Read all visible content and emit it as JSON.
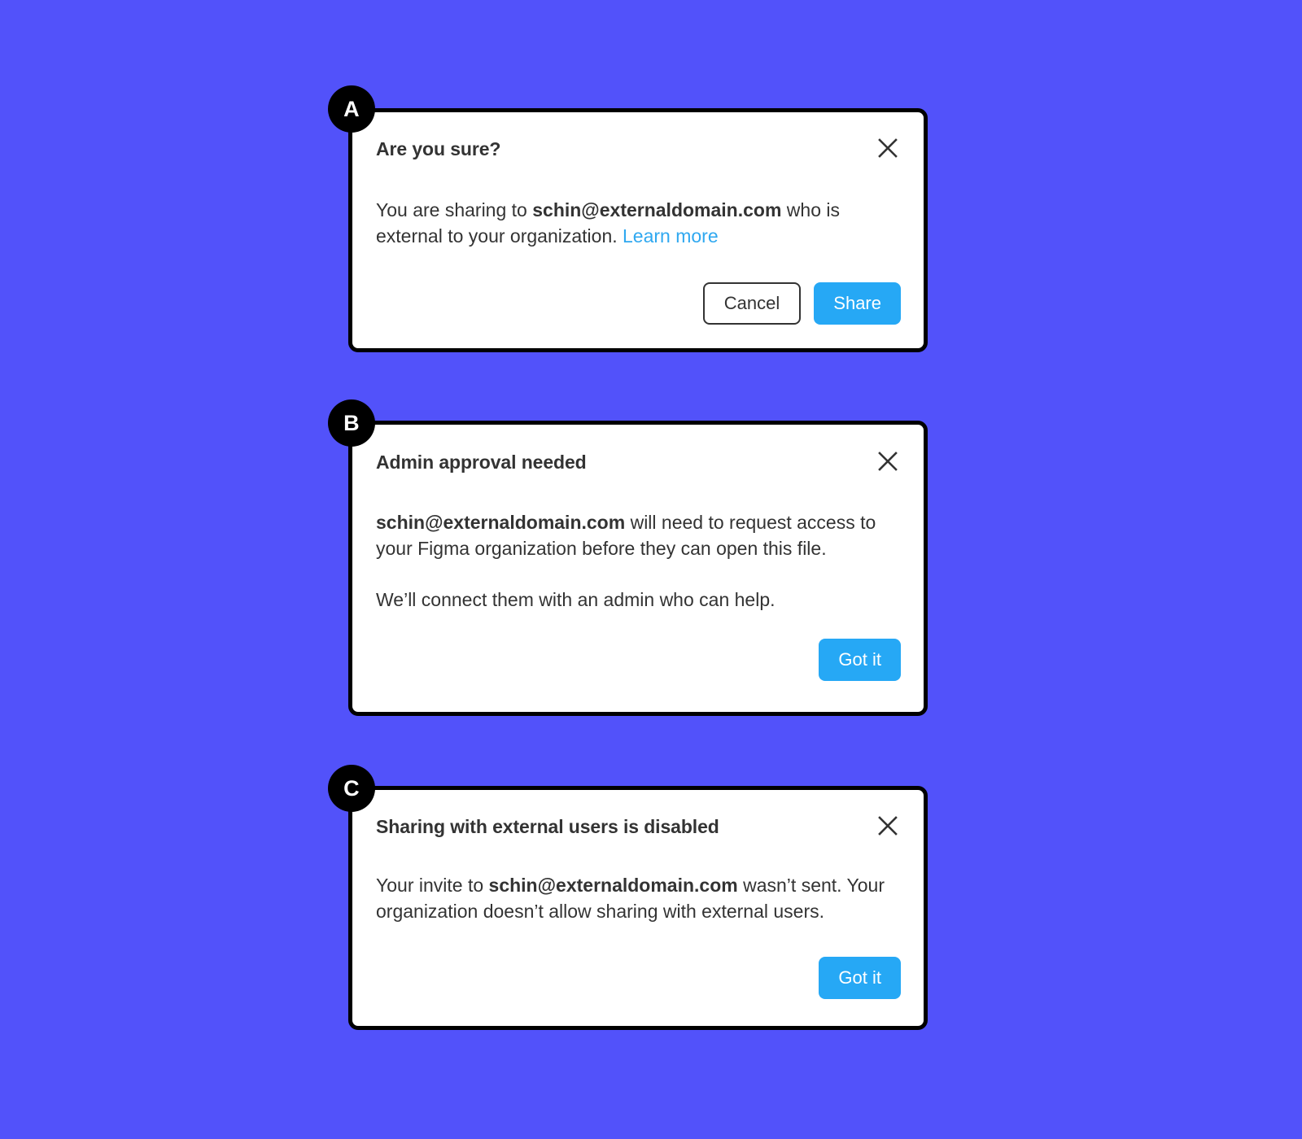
{
  "page": {
    "background_color": "#5252fa",
    "accent_blue": "#26a8f5",
    "link_blue": "#2fa8f0",
    "border_color": "#000000",
    "text_color": "#333333"
  },
  "dialogs": [
    {
      "badge": "A",
      "title": "Are you sure?",
      "close_icon": "close-icon",
      "body": {
        "lead": "You are sharing to ",
        "email": "schin@externaldomain.com",
        "tail": " who is external to your organization. ",
        "link": "Learn more"
      },
      "buttons": {
        "cancel": "Cancel",
        "primary": "Share"
      }
    },
    {
      "badge": "B",
      "title": "Admin approval needed",
      "close_icon": "close-icon",
      "body": {
        "email": "schin@externaldomain.com",
        "tail": " will need to request access to your Figma organization before they can open this file.",
        "paragraph2": "We’ll connect them with an admin who can help."
      },
      "buttons": {
        "primary": "Got it"
      }
    },
    {
      "badge": "C",
      "title": "Sharing with external users is disabled",
      "close_icon": "close-icon",
      "body": {
        "lead": "Your invite to ",
        "email": "schin@externaldomain.com",
        "tail": " wasn’t sent. Your organization doesn’t allow sharing with external users."
      },
      "buttons": {
        "primary": "Got it"
      }
    }
  ]
}
